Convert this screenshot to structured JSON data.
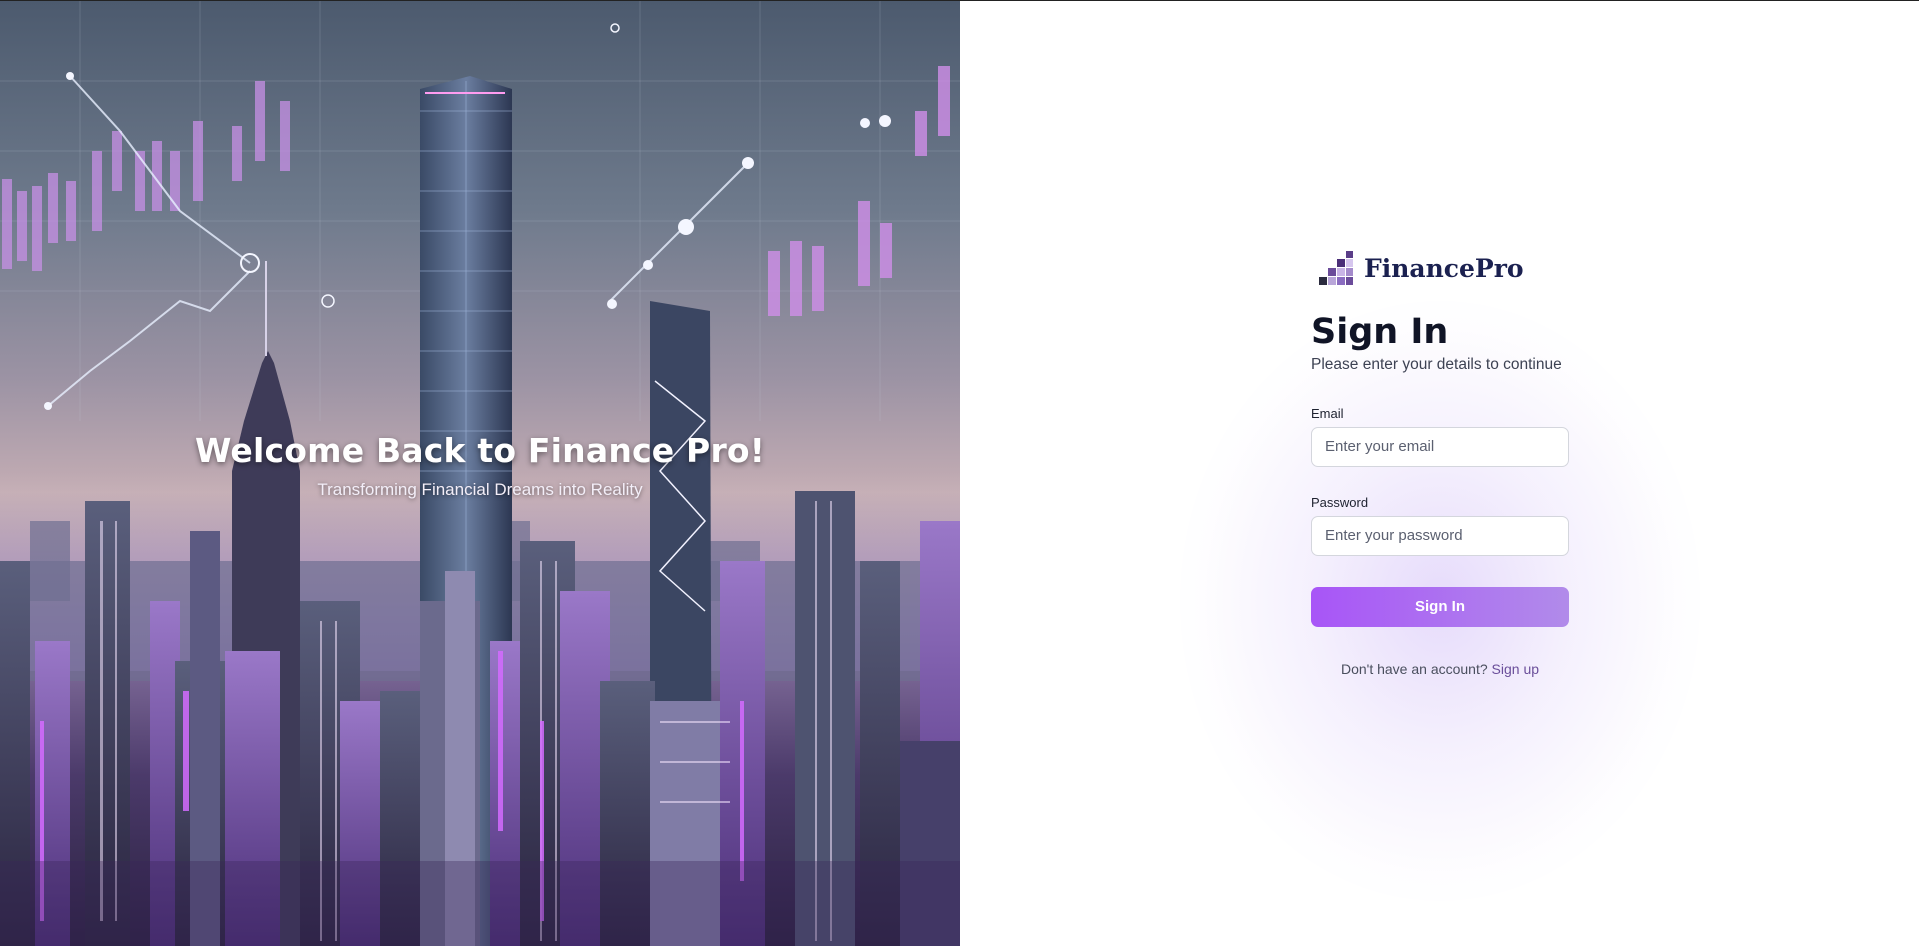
{
  "hero": {
    "title": "Welcome Back to Finance Pro!",
    "subtitle": "Transforming Financial Dreams into Reality"
  },
  "brand": {
    "name": "FinancePro",
    "logo_icon": "bar-steps-logo-icon"
  },
  "form": {
    "title": "Sign In",
    "subtitle": "Please enter your details to continue",
    "email": {
      "label": "Email",
      "placeholder": "Enter your email",
      "value": ""
    },
    "password": {
      "label": "Password",
      "placeholder": "Enter your password",
      "value": ""
    },
    "submit_label": "Sign In",
    "signup_prompt": "Don't have an account?",
    "signup_link": "Sign up"
  },
  "colors": {
    "accent": "#a855f7",
    "brand_text": "#1b2150",
    "hero_text": "#ffffff"
  }
}
